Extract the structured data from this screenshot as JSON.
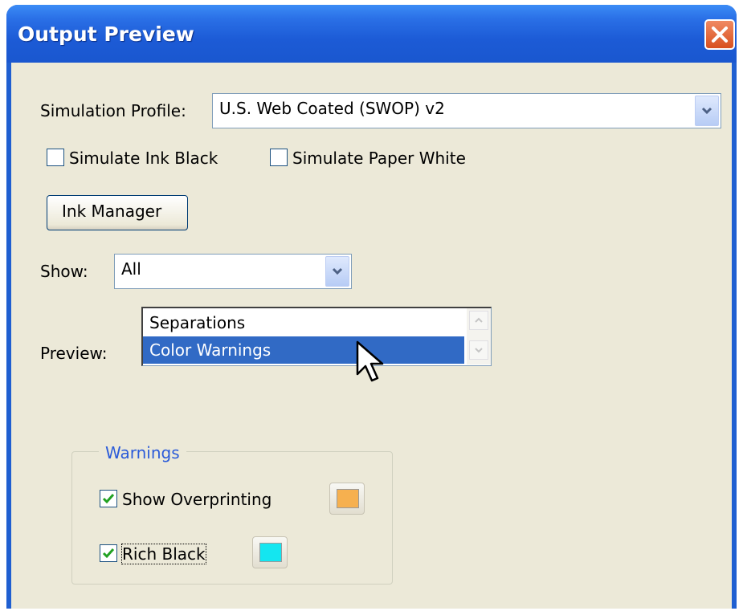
{
  "window": {
    "title": "Output Preview"
  },
  "simulation_profile": {
    "label": "Simulation Profile:",
    "value": "U.S. Web Coated (SWOP) v2"
  },
  "checkboxes": {
    "simulate_ink_black": {
      "label": "Simulate Ink Black",
      "checked": false
    },
    "simulate_paper_white": {
      "label": "Simulate Paper White",
      "checked": false
    }
  },
  "ink_manager": {
    "label": "Ink Manager"
  },
  "show": {
    "label": "Show:",
    "value": "All"
  },
  "preview": {
    "label": "Preview:",
    "options": [
      "Separations",
      "Color Warnings"
    ],
    "selected": "Color Warnings"
  },
  "warnings": {
    "title": "Warnings",
    "show_overprinting": {
      "label": "Show Overprinting",
      "checked": true,
      "color": "#f6b04f"
    },
    "rich_black": {
      "label": "Rich Black",
      "checked": true,
      "color": "#14e6f0"
    }
  },
  "colors": {
    "titlebar": "#1f5fd1",
    "dialog_bg": "#ece9d8",
    "selection": "#316ac5",
    "group_title": "#2b5bd9"
  },
  "icons": {
    "close": "close-icon",
    "dropdown": "chevron-down-icon",
    "cursor": "mouse-pointer-icon"
  }
}
